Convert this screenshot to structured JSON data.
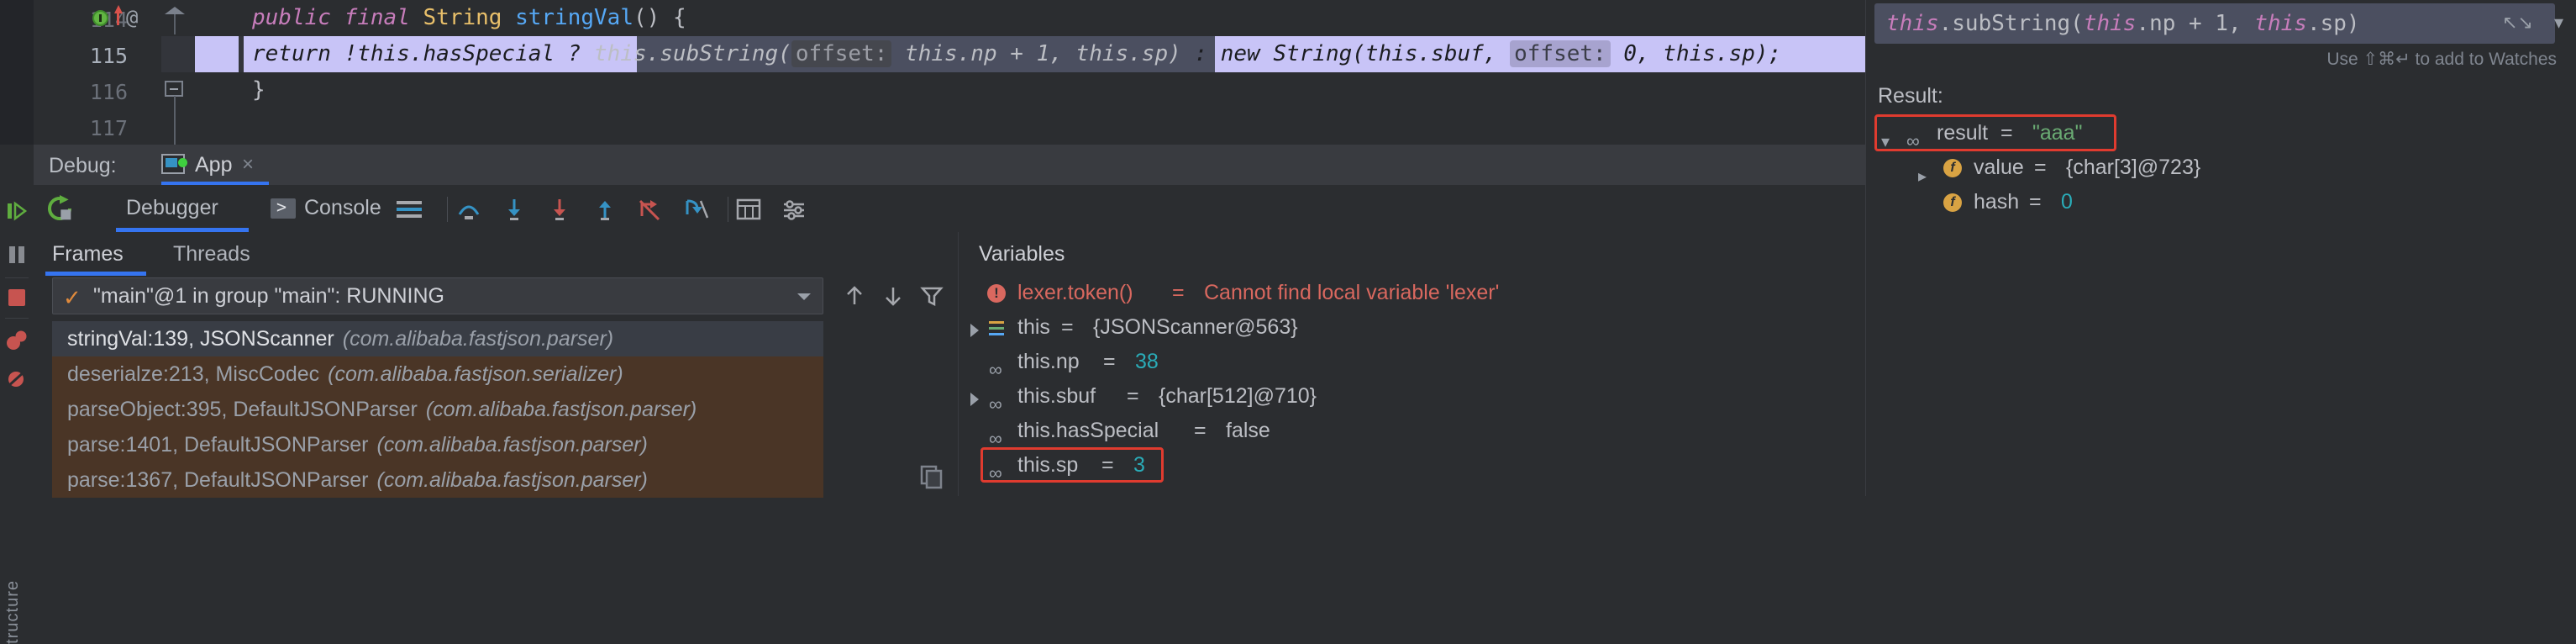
{
  "editor": {
    "lines": [
      {
        "num": "114",
        "indent": "    ",
        "text": "public final String stringVal() {"
      },
      {
        "num": "115",
        "indent": "        ",
        "text": "return !this.hasSpecial ? this.subString( offset: this.np + 1, this.sp) : new String(this.sbuf,  offset: 0, this.sp);"
      },
      {
        "num": "116",
        "indent": "    ",
        "text": "}"
      },
      {
        "num": "117",
        "indent": "",
        "text": ""
      }
    ],
    "line114": {
      "kw_public": "public",
      "kw_final": "final",
      "type_String": "String",
      "fn_name": "stringVal",
      "parens": "() {"
    },
    "line115": {
      "seg_return": "return !this.hasSpecial ? ",
      "seg_this_sub": "this.subString(",
      "hint_offset1": "offset:",
      "seg_args1": " this.np + 1, this.sp)",
      "seg_colon_new": " : new String(this.sbuf, ",
      "hint_offset2": "offset:",
      "seg_args2": " 0, this.sp);"
    },
    "line116": "}",
    "gutter_at": "@"
  },
  "debug_window": {
    "label": "Debug:",
    "tab_title": "App",
    "close": "×",
    "tabs": [
      "Debugger",
      "Console"
    ],
    "active_tab": "Debugger"
  },
  "frames": {
    "tabs": [
      "Frames",
      "Threads"
    ],
    "active_tab": "Frames",
    "thread_selector": "\"main\"@1 in group \"main\": RUNNING",
    "items": [
      {
        "method": "stringVal:139, JSONScanner",
        "pkg": "(com.alibaba.fastjson.parser)",
        "selected": true
      },
      {
        "method": "deserialze:213, MiscCodec",
        "pkg": "(com.alibaba.fastjson.serializer)",
        "selected": false
      },
      {
        "method": "parseObject:395, DefaultJSONParser",
        "pkg": "(com.alibaba.fastjson.parser)",
        "selected": false
      },
      {
        "method": "parse:1401, DefaultJSONParser",
        "pkg": "(com.alibaba.fastjson.parser)",
        "selected": false
      },
      {
        "method": "parse:1367, DefaultJSONParser",
        "pkg": "(com.alibaba.fastjson.parser)",
        "selected": false
      }
    ]
  },
  "variables": {
    "title": "Variables",
    "items": [
      {
        "icon": "error-icon",
        "name": "lexer.token()",
        "eq": " = ",
        "value": "Cannot find local variable 'lexer'",
        "value_kind": "error",
        "expandable": false,
        "indent": 0
      },
      {
        "icon": "list-icon",
        "name": "this",
        "eq": " = ",
        "value": "{JSONScanner@563}",
        "value_kind": "object",
        "expandable": true,
        "indent": 0
      },
      {
        "icon": "chain-icon",
        "name": "this.np",
        "eq": " = ",
        "value": "38",
        "value_kind": "number",
        "expandable": false,
        "indent": 0
      },
      {
        "icon": "chain-icon",
        "name": "this.sbuf",
        "eq": " = ",
        "value": "{char[512]@710}",
        "value_kind": "object",
        "expandable": true,
        "indent": 0
      },
      {
        "icon": "chain-icon",
        "name": "this.hasSpecial",
        "eq": " = ",
        "value": "false",
        "value_kind": "object",
        "expandable": false,
        "indent": 0
      },
      {
        "icon": "chain-icon",
        "name": "this.sp",
        "eq": " = ",
        "value": "3",
        "value_kind": "number",
        "expandable": false,
        "indent": 0,
        "highlighted": true
      }
    ]
  },
  "evaluate_panel": {
    "expression": {
      "this_kw": "this",
      "dot_sub": ".subString(",
      "this_kw2": "this",
      "np_plus": ".np + 1, ",
      "this_kw3": "this",
      "sp_close": ".sp)"
    },
    "expression_plain": "this.subString(this.np + 1, this.sp)",
    "hint": "Use ⇧⌘↵ to add to Watches",
    "result_label": "Result:",
    "results": [
      {
        "icon": "chain-icon",
        "chevron": "down",
        "name": "result",
        "eq": " = ",
        "value": "\"aaa\"",
        "value_kind": "string",
        "indent": 0,
        "highlighted": true
      },
      {
        "icon": "field-icon",
        "chevron": "right",
        "name": "value",
        "eq": " = ",
        "value": "{char[3]@723}",
        "value_kind": "object",
        "indent": 1
      },
      {
        "icon": "field-icon",
        "chevron": "none",
        "name": "hash",
        "eq": " = ",
        "value": "0",
        "value_kind": "number",
        "indent": 1
      }
    ]
  },
  "side_rail": {
    "vertical_label": "tructure",
    "buttons": [
      "resume-program",
      "pause-program",
      "stop-program",
      "view-breakpoints",
      "mute-breakpoints"
    ]
  },
  "colors": {
    "accent_blue": "#3574f0",
    "selection_lavender": "#c8c4f7",
    "exec_highlight": "#4b4f60",
    "red_annotation": "#e03b2f",
    "library_frame_bg": "#4a3526",
    "string_green": "#6aab73",
    "number_cyan": "#2aacb8",
    "error_red": "#d9685f",
    "bg": "#2b2d30"
  }
}
